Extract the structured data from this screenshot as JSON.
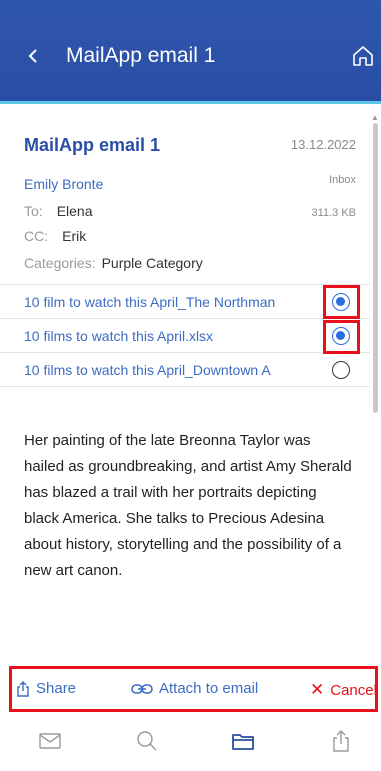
{
  "header": {
    "title": "MailApp email 1",
    "back_icon": "chevron-left-icon",
    "home_icon": "home-icon"
  },
  "email": {
    "subject": "MailApp email 1",
    "date": "13.12.2022",
    "sender": "Emily Bronte",
    "folder": "Inbox",
    "to_label": "To:",
    "to_value": "Elena",
    "size": "311.3 KB",
    "cc_label": "CC:",
    "cc_value": "Erik",
    "categories_label": "Categories:",
    "categories_value": "Purple Category"
  },
  "attachments": [
    {
      "name": "10 film to watch this April_The Northman",
      "selected": true
    },
    {
      "name": "10 films to watch this April.xlsx",
      "selected": true
    },
    {
      "name": "10 films to watch this April_Downtown A",
      "selected": false
    }
  ],
  "body": "Her painting of the late Breonna Taylor was hailed as groundbreaking, and artist Amy Sherald has blazed a trail with her portraits depicting black America. She talks to Precious Adesina about history, storytelling and the possibility of a new art canon.",
  "actions": {
    "share": "Share",
    "attach": "Attach to email",
    "cancel": "Cancel"
  },
  "colors": {
    "header": "#2a4ea5",
    "accent": "#3c6cc4",
    "highlight": "#e8101b",
    "radio": "#2a6de0"
  },
  "tabbar": [
    "mail-icon",
    "search-icon",
    "folder-icon",
    "share-icon"
  ]
}
